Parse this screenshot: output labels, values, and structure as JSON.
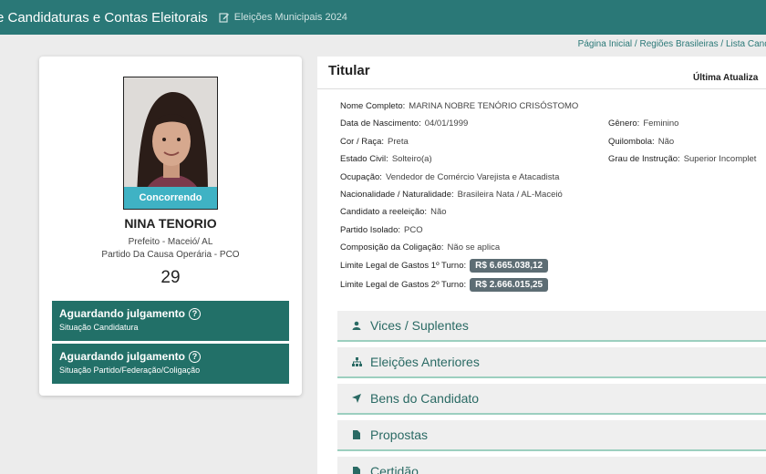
{
  "header": {
    "title": "e Candidaturas e Contas Eleitorais",
    "edit_label": "Eleições Municipais 2024",
    "edit_icon": "edit-icon"
  },
  "breadcrumb": "Página Inicial / Regiões Brasileiras / Lista Candi",
  "candidate": {
    "photo_status": "Concorrendo",
    "name": "NINA TENORIO",
    "office": "Prefeito - Maceió/ AL",
    "party": "Partido Da Causa Operária - PCO",
    "number": "29",
    "status_boxes": [
      {
        "title": "Aguardando julgamento",
        "subtitle": "Situação Candidatura"
      },
      {
        "title": "Aguardando julgamento",
        "subtitle": "Situação Partido/Federação/Coligação"
      }
    ]
  },
  "details": {
    "title": "Titular",
    "last_update": "Última Atualiza",
    "fields": {
      "nome_label": "Nome Completo:",
      "nome": "MARINA NOBRE TENÓRIO CRISÓSTOMO",
      "nasc_label": "Data de Nascimento:",
      "nasc": "04/01/1999",
      "genero_label": "Gênero:",
      "genero": "Feminino",
      "cor_label": "Cor / Raça:",
      "cor": "Preta",
      "quilombola_label": "Quilombola:",
      "quilombola": "Não",
      "civil_label": "Estado Civil:",
      "civil": "Solteiro(a)",
      "instrucao_label": "Grau de Instrução:",
      "instrucao": "Superior Incomplet",
      "ocup_label": "Ocupação:",
      "ocup": "Vendedor de Comércio Varejista e Atacadista",
      "nac_label": "Nacionalidade / Naturalidade:",
      "nac": "Brasileira Nata / AL-Maceió",
      "reeleicao_label": "Candidato a reeleição:",
      "reeleicao": "Não",
      "partido_label": "Partido Isolado:",
      "partido": "PCO",
      "coligacao_label": "Composição da Coligação:",
      "coligacao": "Não se aplica",
      "limite1_label": "Limite Legal de Gastos 1º Turno:",
      "limite1": "R$ 6.665.038,12",
      "limite2_label": "Limite Legal de Gastos 2º Turno:",
      "limite2": "R$ 2.666.015,25"
    }
  },
  "sections": [
    {
      "label": "Vices / Suplentes",
      "icon": "user-icon"
    },
    {
      "label": "Eleições Anteriores",
      "icon": "sitemap-icon"
    },
    {
      "label": "Bens do Candidato",
      "icon": "location-arrow-icon"
    },
    {
      "label": "Propostas",
      "icon": "file-icon"
    },
    {
      "label": "Certidão",
      "icon": "file-icon"
    }
  ]
}
